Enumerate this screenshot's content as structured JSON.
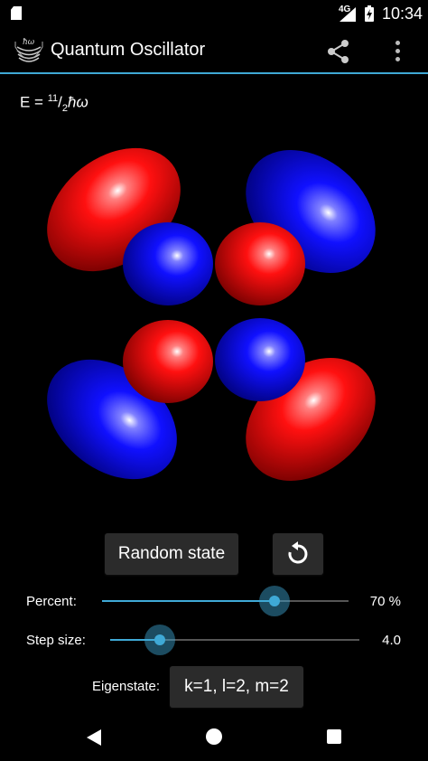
{
  "status_bar": {
    "network": "4G",
    "time": "10:34"
  },
  "app_bar": {
    "title": "Quantum Oscillator",
    "logo_text": "ħω"
  },
  "energy": {
    "prefix": "E = ",
    "numerator": "11",
    "slash": "/",
    "denominator": "2",
    "unit": "ħω"
  },
  "controls": {
    "random_label": "Random state",
    "percent": {
      "label": "Percent:",
      "value_text": "70 %",
      "fraction": 0.7
    },
    "step": {
      "label": "Step size:",
      "value_text": "4.0",
      "fraction": 0.2
    },
    "eigen": {
      "label": "Eigenstate:",
      "button_label": "k=1, l=2, m=2"
    }
  },
  "colors": {
    "accent": "#3fa9d6",
    "positive_lobe": "#ff1010",
    "negative_lobe": "#1010ff"
  }
}
